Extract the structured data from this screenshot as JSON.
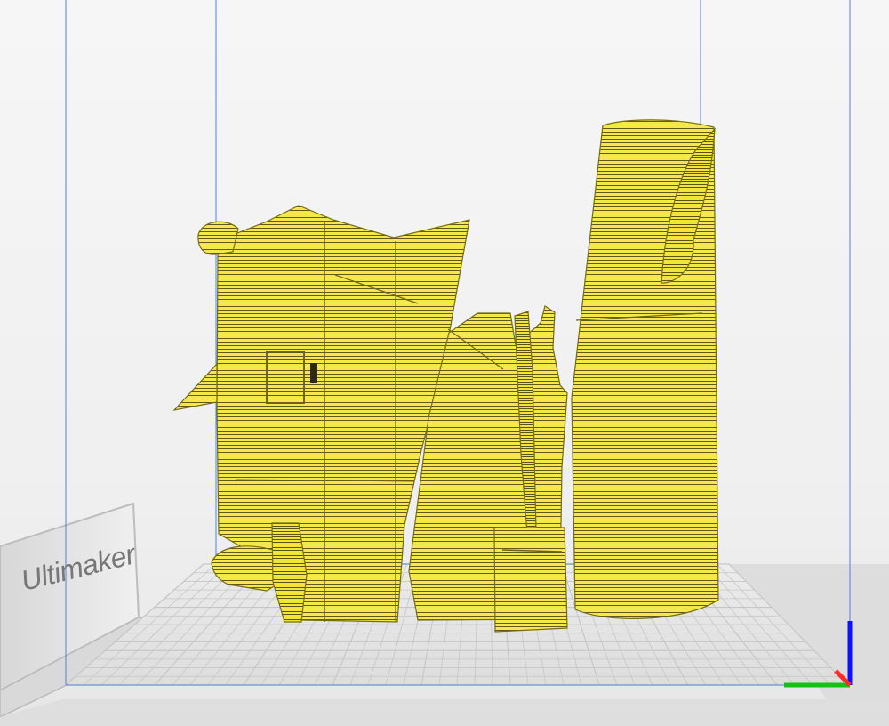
{
  "app": {
    "brand_label": "Ultimaker"
  },
  "viewport": {
    "object_color": "#f6e84a",
    "object_line_color": "#4f4a12",
    "build_volume_line_color": "#4d84d6",
    "grid_color": "#c6c6c6",
    "plate_color": "#e2e2e2",
    "axis_colors": {
      "x": "#ff2a2a",
      "y": "#11c411",
      "z": "#1010ff"
    }
  }
}
